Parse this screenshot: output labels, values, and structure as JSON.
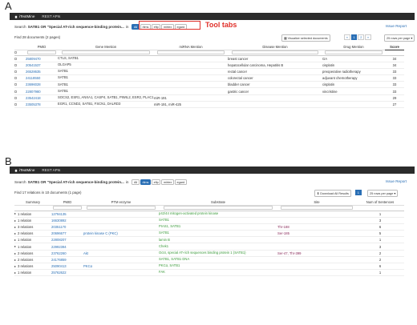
{
  "panel_a": {
    "letter": "A",
    "nav": {
      "brand": "iTextMine",
      "api": "REST APIs"
    },
    "search_prefix": "Search",
    "search_query": "SATB1 OR \"Special AT-rich sequence-binding protein...",
    "search_in": "in",
    "tabs": [
      "All",
      "rlims",
      "efip",
      "mirtex",
      "egard"
    ],
    "active_tab": "All",
    "tool_tabs_label": "Tool tabs",
    "issue_report": "Issue Report",
    "found": "Find 28 documents (2 pages)",
    "visualize_button": "Visualize selected documents",
    "pages": [
      "«",
      "1",
      "2",
      "»"
    ],
    "rows_per_page": "25 rows per page ▾",
    "columns": [
      "",
      "PMID",
      "Gene Mention",
      "miRNA Mention",
      "Disease Mention",
      "Drug Mention",
      "Score"
    ],
    "rows": [
      {
        "pmid": "25809470",
        "gene": "CTLS, SATB1",
        "mirna": "",
        "disease": "breast cancer",
        "drug": "GA",
        "score": "34"
      },
      {
        "pmid": "20541537",
        "gene": "OLGAP5",
        "mirna": "",
        "disease": "hepatocellular carcinoma, Hepatitis B",
        "drug": "cisplatin",
        "score": "34"
      },
      {
        "pmid": "26528635",
        "gene": "SATB1",
        "mirna": "",
        "disease": "rectal cancer",
        "drug": "preoperative radiotherapy",
        "score": "33"
      },
      {
        "pmid": "24118550",
        "gene": "SATB1",
        "mirna": "",
        "disease": "colorectal cancer",
        "drug": "adjuvant chemotherapy",
        "score": "33"
      },
      {
        "pmid": "23696028",
        "gene": "SATB1",
        "mirna": "",
        "disease": "bladder cancer",
        "drug": "cisplatin",
        "score": "33"
      },
      {
        "pmid": "22807980",
        "gene": "SATB1",
        "mirna": "",
        "disease": "gastric cancer",
        "drug": "vincristine",
        "score": "33"
      },
      {
        "pmid": "23542418",
        "gene": "SOCS2, ESR1, ANXA1, CASP4, SATB1, PIWIL2, ESR2, PLAC1",
        "mirna": "miR-191",
        "disease": "",
        "drug": "",
        "score": "29"
      },
      {
        "pmid": "23505378",
        "gene": "EGR1, CCND2, SATB1, FSCN1, DALRD3",
        "mirna": "miR-191, miR-425",
        "disease": "",
        "drug": "",
        "score": "27"
      }
    ]
  },
  "panel_b": {
    "letter": "B",
    "nav": {
      "brand": "iTextMine",
      "api": "REST APIs"
    },
    "search_prefix": "Search",
    "search_query": "SATB1 OR \"Special AT-rich sequence-binding protein...",
    "search_in": "in",
    "tabs": [
      "All",
      "rlims",
      "efip",
      "mirtex",
      "egard"
    ],
    "active_tab": "rlims",
    "issue_report": "Issue Report",
    "found": "Find 17 relations in 10 documents (1 page)",
    "download_button": "Download All Results",
    "pages": [
      "1"
    ],
    "rows_per_page": "25 rows per page ▾",
    "columns": [
      "Summary",
      "PMID",
      "PTM enzyme",
      "Substrate",
      "Site",
      "Num of Sentences"
    ],
    "rows": [
      {
        "summary": "1 relation",
        "pmid": "12794135",
        "enzyme": "",
        "substrate": "p42/44 mitogen-activated protein kinase",
        "site": "",
        "num": "1"
      },
      {
        "summary": "1 relation",
        "pmid": "16630892",
        "enzyme": "",
        "substrate": "SATB1",
        "site": "",
        "num": "3"
      },
      {
        "summary": "3 relations",
        "pmid": "20351170",
        "enzyme": "",
        "substrate": "PIAS1, SATB1",
        "site": "Thr-188",
        "num": "6"
      },
      {
        "summary": "2 relations",
        "pmid": "20696677",
        "enzyme": "protein kinase C (PKC)",
        "substrate": "SATB1",
        "site": "Ser-185",
        "num": "5"
      },
      {
        "summary": "1 relation",
        "pmid": "22808207",
        "enzyme": "",
        "substrate": "lamin B",
        "site": "",
        "num": "1"
      },
      {
        "summary": "1 relation",
        "pmid": "22992394",
        "enzyme": "",
        "substrate": "Chek1",
        "site": "",
        "num": "3"
      },
      {
        "summary": "2 relations",
        "pmid": "23762260",
        "enzyme": "Akt",
        "substrate": "Oct4, special AT-rich sequences binding protein 1 (SATB1)",
        "site": "Ser-47, Thr-399",
        "num": "2"
      },
      {
        "summary": "2 relations",
        "pmid": "24176859",
        "enzyme": "",
        "substrate": "SATB1, SATB1 DNA",
        "site": "",
        "num": "2"
      },
      {
        "summary": "3 relations",
        "pmid": "25090413",
        "enzyme": "PKCα",
        "substrate": "PKCα, SATB1",
        "site": "",
        "num": "6"
      },
      {
        "summary": "1 relation",
        "pmid": "25762622",
        "enzyme": "",
        "substrate": "FAK",
        "site": "",
        "num": "1"
      }
    ]
  },
  "colors": {
    "navbar": "#2b2b2b",
    "link": "#2a6fb5",
    "entity_green": "#3a9a3a",
    "site_maroon": "#8a2b5a",
    "highlight_red": "#e0302a"
  },
  "icons": {
    "home": "home-icon",
    "expand": "triangle-right-icon",
    "checkbox": "checkbox-icon"
  }
}
